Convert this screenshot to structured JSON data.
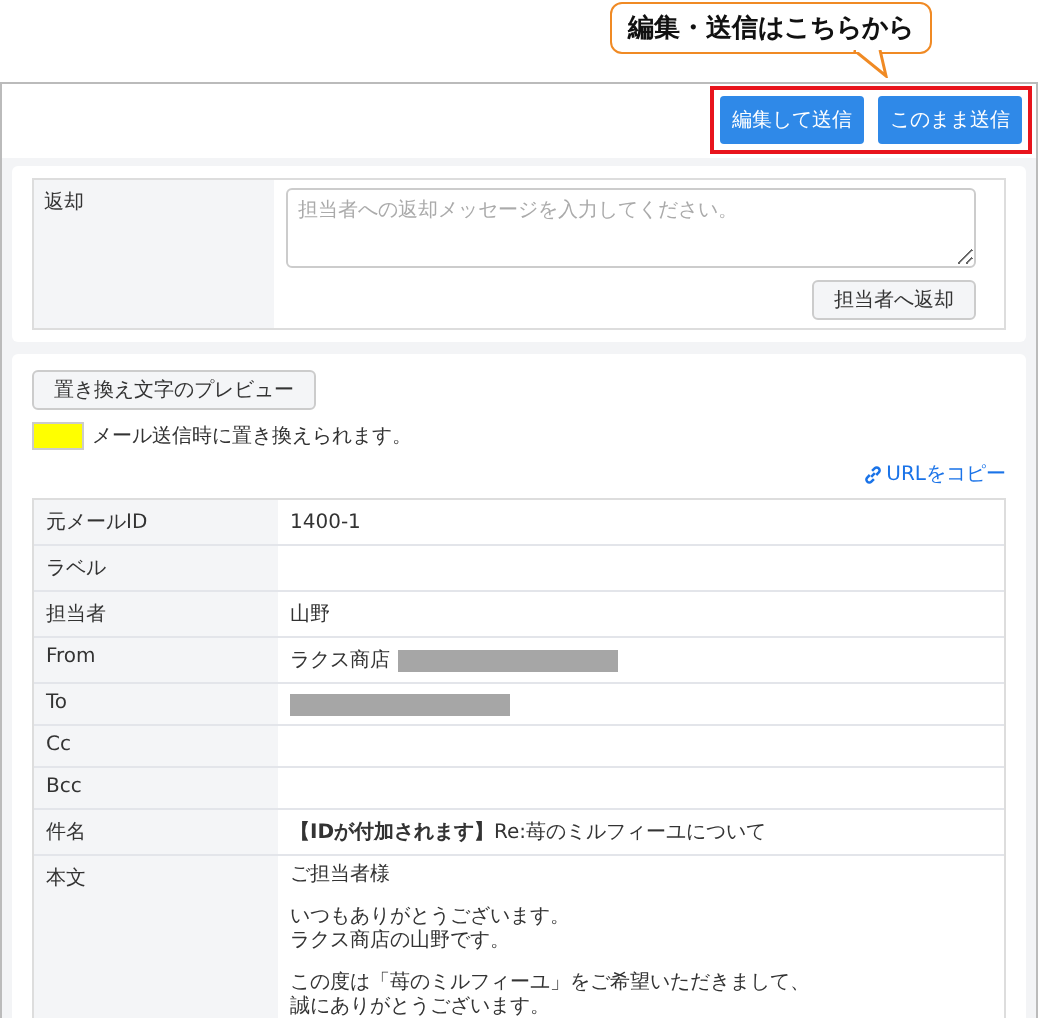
{
  "callout": {
    "text": "編集・送信はこちらから"
  },
  "header": {
    "highlighted": true,
    "buttons": [
      "編集して送信",
      "このまま送信"
    ]
  },
  "return_panel": {
    "label": "返却",
    "placeholder": "担当者への返却メッセージを入力してください。",
    "button": "担当者へ返却"
  },
  "preview_button": "置き換え文字のプレビュー",
  "legend": {
    "color": "#ffff00",
    "text": "メール送信時に置き換えられます。"
  },
  "copy_link": "URLをコピー",
  "fields": [
    {
      "label": "元メールID",
      "value": "1400-1",
      "redacted": false
    },
    {
      "label": "ラベル",
      "redacted": false
    },
    {
      "label": "担当者",
      "value": "山野",
      "redacted": false
    },
    {
      "label": "From",
      "value": "ラクス商店",
      "redacted": true
    },
    {
      "label": "To",
      "redacted": true
    },
    {
      "label": "Cc",
      "redacted": false
    },
    {
      "label": "Bcc",
      "redacted": false
    },
    {
      "label": "件名",
      "value": "**【IDが付加されます】**Re:苺のミルフィーユについて",
      "redacted": false
    }
  ],
  "body": {
    "label": "本文",
    "paragraphs": [
      [
        "ご担当者様"
      ],
      [
        "いつもありがとうございます。",
        "ラクス商店の山野です。"
      ],
      [
        "この度は「苺のミルフィーユ」をご希望いただきまして、",
        "誠にありがとうございます。"
      ]
    ]
  }
}
